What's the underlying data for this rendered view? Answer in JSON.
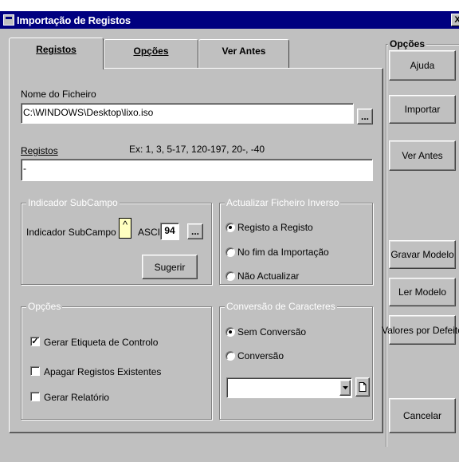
{
  "window": {
    "title": "Importação de Registos",
    "close": "X"
  },
  "tabs": [
    {
      "label": "Registos"
    },
    {
      "label": "Opções"
    },
    {
      "label": "Ver Antes"
    }
  ],
  "file": {
    "label": "Nome do Ficheiro",
    "value": "C:\\WINDOWS\\Desktop\\lixo.iso",
    "browse": "..."
  },
  "records": {
    "label": "Registos",
    "hint": "Ex: 1,  3,  5-17, 120-197, 20-, -40",
    "value": "-"
  },
  "subfield": {
    "group": "Indicador SubCampo",
    "label": "Indicador SubCampo",
    "char": "^",
    "ascii_label": "ASCII",
    "ascii_value": "94",
    "more": "...",
    "suggest": "Sugerir"
  },
  "inverse": {
    "group": "Actualizar Ficheiro Inverso",
    "options": [
      "Registo a Registo",
      "No fim da Importação",
      "Não Actualizar"
    ],
    "selected": 0
  },
  "options": {
    "group": "Opções",
    "items": [
      {
        "label": "Gerar Etiqueta de Controlo",
        "checked": true
      },
      {
        "label": "Apagar Registos Existentes",
        "checked": false
      },
      {
        "label": "Gerar Relatório",
        "checked": false
      }
    ]
  },
  "conversion": {
    "group": "Conversão de Caracteres",
    "options": [
      "Sem Conversão",
      "Conversão"
    ],
    "selected": 0,
    "combo_value": ""
  },
  "side": {
    "group": "Opções",
    "buttons": [
      "Ajuda",
      "Importar",
      "Ver Antes",
      "Gravar Modelo",
      "Ler Modelo",
      "Valores por Defeito",
      "Cancelar"
    ]
  }
}
